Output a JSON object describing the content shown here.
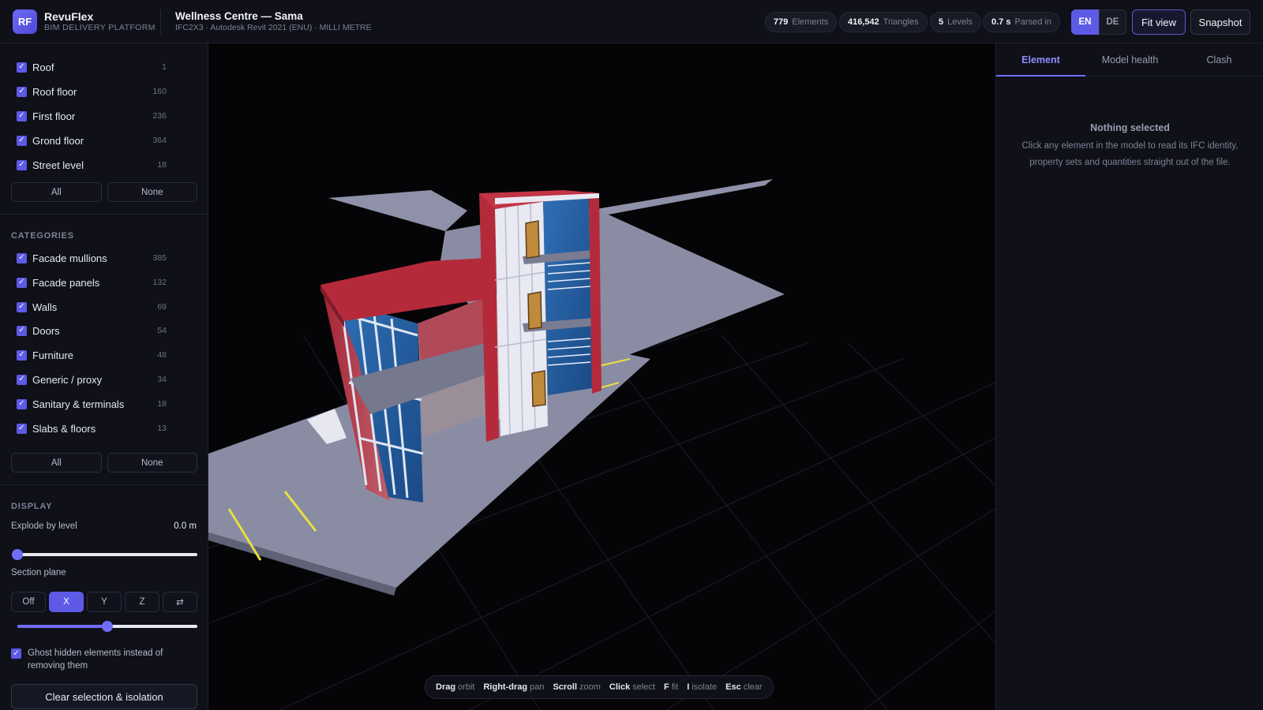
{
  "header": {
    "logo": "RF",
    "brand_name": "RevuFlex",
    "brand_sub": "BIM DELIVERY PLATFORM",
    "project_title": "Wellness Centre — Sama",
    "project_sub": "IFC2X3 · Autodesk Revit 2021 (ENU) · MILLI METRE",
    "stats": [
      {
        "value": "779",
        "label": "Elements"
      },
      {
        "value": "416,542",
        "label": "Triangles"
      },
      {
        "value": "5",
        "label": "Levels"
      },
      {
        "value": "0.7 s",
        "label": "Parsed in"
      }
    ],
    "lang_en": "EN",
    "lang_de": "DE",
    "fit_view": "Fit view",
    "snapshot": "Snapshot"
  },
  "levels": {
    "items": [
      {
        "label": "Roof",
        "count": "1"
      },
      {
        "label": "Roof floor",
        "count": "160"
      },
      {
        "label": "First floor",
        "count": "236"
      },
      {
        "label": "Grond floor",
        "count": "364"
      },
      {
        "label": "Street level",
        "count": "18"
      }
    ],
    "all": "All",
    "none": "None"
  },
  "categories": {
    "title": "CATEGORIES",
    "items": [
      {
        "label": "Facade mullions",
        "count": "385"
      },
      {
        "label": "Facade panels",
        "count": "132"
      },
      {
        "label": "Walls",
        "count": "69"
      },
      {
        "label": "Doors",
        "count": "54"
      },
      {
        "label": "Furniture",
        "count": "48"
      },
      {
        "label": "Generic / proxy",
        "count": "34"
      },
      {
        "label": "Sanitary & terminals",
        "count": "18"
      },
      {
        "label": "Slabs & floors",
        "count": "13"
      }
    ],
    "all": "All",
    "none": "None"
  },
  "display": {
    "title": "DISPLAY",
    "explode_label": "Explode by level",
    "explode_value": "0.0 m",
    "explode_fraction": 0.0,
    "section_label": "Section plane",
    "section_options": [
      "Off",
      "X",
      "Y",
      "Z",
      "⇄"
    ],
    "section_active": "X",
    "section_fraction": 0.5,
    "ghost_label": "Ghost hidden elements instead of removing them",
    "clear_button": "Clear selection & isolation"
  },
  "hints": [
    {
      "key": "Drag",
      "action": "orbit"
    },
    {
      "key": "Right-drag",
      "action": "pan"
    },
    {
      "key": "Scroll",
      "action": "zoom"
    },
    {
      "key": "Click",
      "action": "select"
    },
    {
      "key": "F",
      "action": "fit"
    },
    {
      "key": "I",
      "action": "isolate"
    },
    {
      "key": "Esc",
      "action": "clear"
    }
  ],
  "panel": {
    "tabs": [
      "Element",
      "Model health",
      "Clash"
    ],
    "active_tab": "Element",
    "empty_title": "Nothing selected",
    "empty_body": "Click any element in the model to read its IFC identity, property sets and quantities straight out of the file."
  },
  "colors": {
    "accent": "#5d5ae6",
    "roof_red": "#b52a3a",
    "glass_blue": "#3d7fc4",
    "slab_grey": "#8d8fa6"
  }
}
